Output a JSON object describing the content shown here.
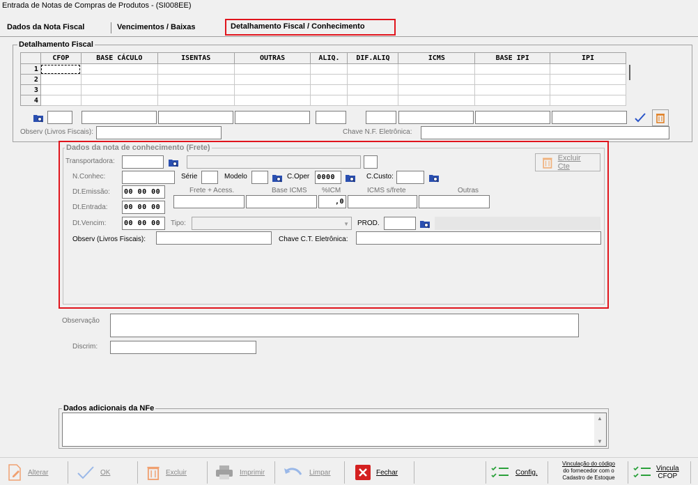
{
  "window": {
    "title": "Entrada de Notas de Compras de Produtos  - (SI008EE)"
  },
  "tabs": [
    {
      "label": "Dados da Nota Fiscal"
    },
    {
      "label": "Vencimentos / Baixas"
    },
    {
      "label": "Detalhamento Fiscal / Conhecimento"
    }
  ],
  "fiscal": {
    "legend": "Detalhamento Fiscal",
    "columns": [
      "CFOP",
      "BASE CÁCULO",
      "ISENTAS",
      "OUTRAS",
      "ALIQ.",
      "DIF.ALIQ",
      "ICMS",
      "BASE IPI",
      "IPI"
    ],
    "rows": [
      "1",
      "2",
      "3",
      "4"
    ],
    "observ_label": "Observ (Livros Fiscais):",
    "chave_label": "Chave N.F. Eletrônica:"
  },
  "frete": {
    "legend": "Dados da nota de conhecimento (Frete)",
    "transportadora_label": "Transportadora:",
    "excluir_cte_label": "Excluir Cte",
    "nconhec_label": "N.Conhec:",
    "serie_label": "Série",
    "modelo_label": "Modelo",
    "coper_label": "C.Oper",
    "coper_value": "0000",
    "ccusto_label": "C.Custo:",
    "dtemissao_label": "Dt.Emissão:",
    "dtentrada_label": "Dt.Entrada:",
    "dtvencim_label": "Dt.Vencim:",
    "date_mask": "00 00 00",
    "frete_acess_label": "Frete + Acess.",
    "base_icms_label": "Base ICMS",
    "pct_icm_label": "%ICM",
    "pct_icm_value": ",0",
    "icms_frete_label": "ICMS s/frete",
    "outras_label": "Outras",
    "tipo_label": "Tipo:",
    "prod_label": "PROD.",
    "observ_label": "Observ (Livros Fiscais):",
    "chave_ct_label": "Chave C.T. Eletrônica:"
  },
  "observacao_label": "Observação",
  "discrim_label": "Discrim:",
  "nfe": {
    "legend": "Dados adicionais da NFe"
  },
  "toolbar": {
    "alterar": "Alterar",
    "ok": "OK",
    "excluir": "Excluir",
    "imprimir": "Imprimir",
    "limpar": "Limpar",
    "fechar": "Fechar",
    "config": "Config.",
    "vinculacao_line1": "Vinculação do código",
    "vinculacao_line2": "do fornecedor com o",
    "vinculacao_line3": "Cadastro de Estoque",
    "vincula_line1": "Vincula",
    "vincula_line2": "CFOP"
  }
}
